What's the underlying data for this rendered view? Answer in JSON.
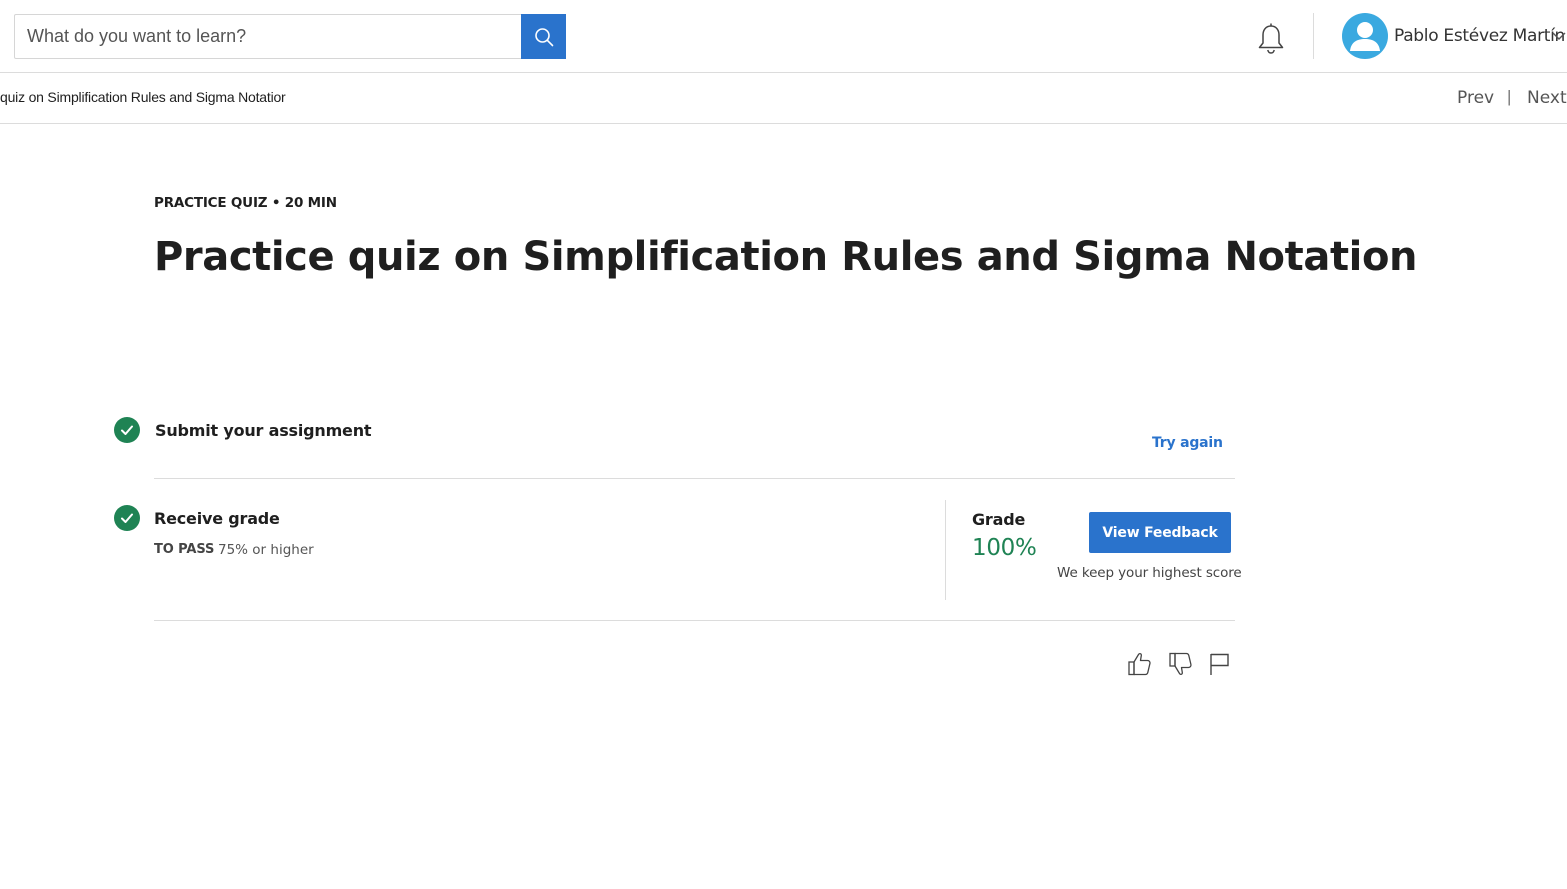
{
  "header": {
    "search": {
      "placeholder": "What do you want to learn?",
      "value": ""
    },
    "user": {
      "name": "Pablo Estévez Martín"
    }
  },
  "breadcrumb": {
    "text": "quiz on Simplification Rules and Sigma Notatior",
    "prev_label": "Prev",
    "separator": "|",
    "next_label": "Next"
  },
  "quiz": {
    "eyebrow": "PRACTICE QUIZ • 20 MIN",
    "title": "Practice quiz on Simplification Rules and Sigma Notation"
  },
  "steps": {
    "submit": {
      "title": "Submit your assignment",
      "action_label": "Try again",
      "completed": true
    },
    "grade": {
      "title": "Receive grade",
      "pass_label": "TO PASS",
      "pass_value": "75% or higher",
      "grade_label": "Grade",
      "grade_value": "100%",
      "feedback_label": "View Feedback",
      "note": "We keep your highest score",
      "completed": true
    }
  },
  "icons": {
    "search": "search-icon",
    "notifications": "bell-icon",
    "avatar": "user-avatar-icon",
    "dropdown": "chevron-down-icon",
    "check": "check-icon",
    "like": "thumbs-up-icon",
    "dislike": "thumbs-down-icon",
    "report": "flag-icon"
  },
  "colors": {
    "accent": "#2a73cc",
    "success": "#1f8354",
    "avatar_bg": "#3aa9e0"
  }
}
